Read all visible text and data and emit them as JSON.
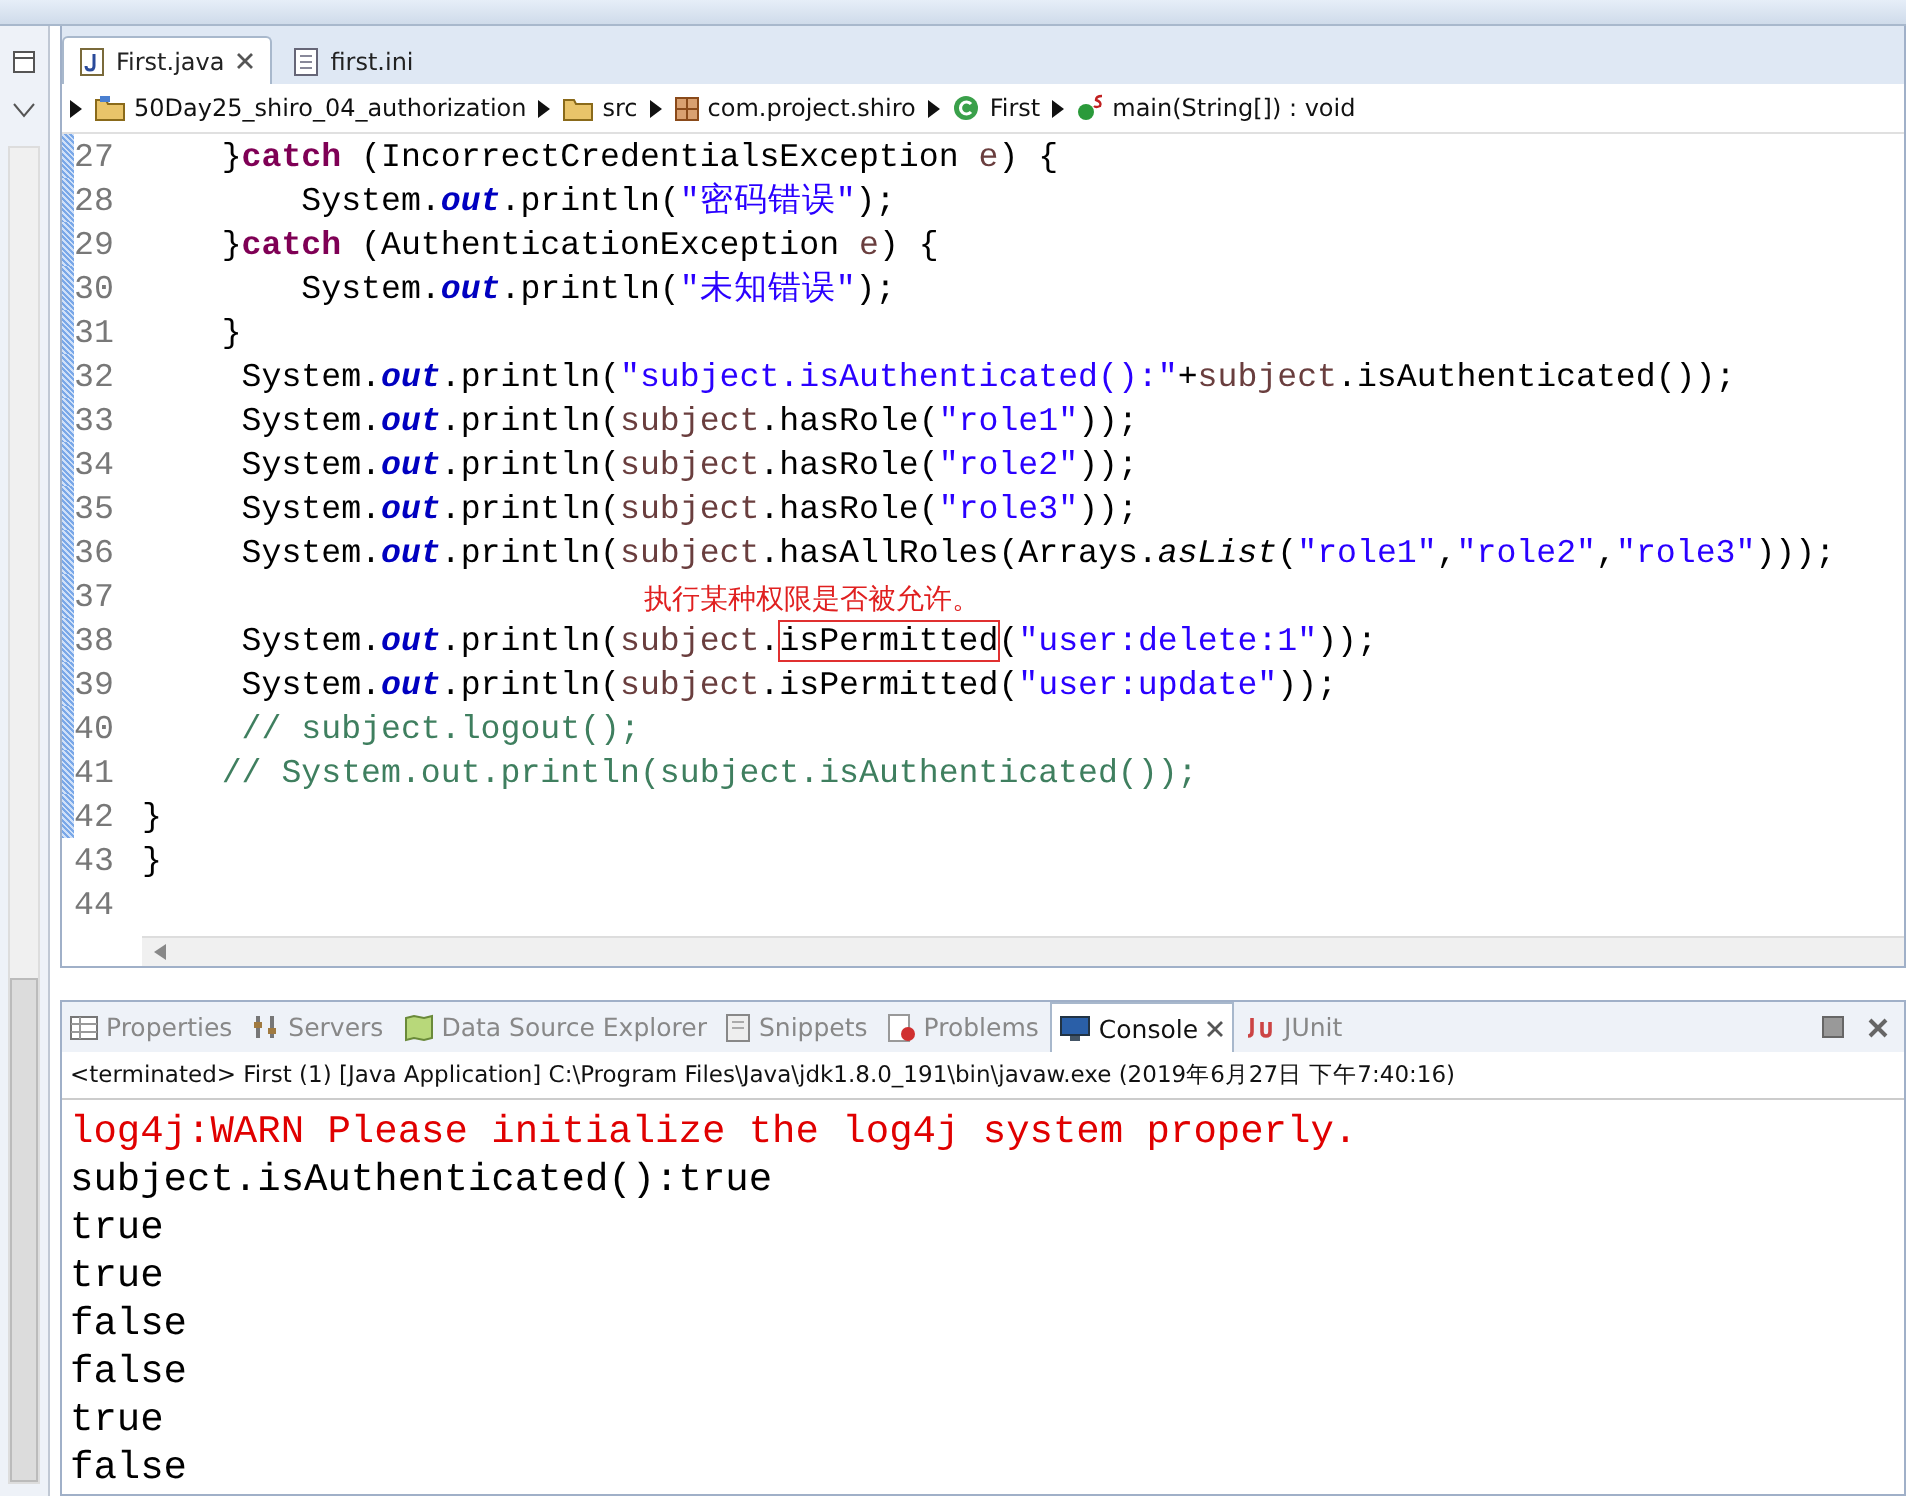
{
  "editor_tabs": [
    {
      "label": "First.java",
      "kind": "java",
      "selected": true,
      "closable": true
    },
    {
      "label": "first.ini",
      "kind": "file",
      "selected": false,
      "closable": false
    }
  ],
  "breadcrumb": [
    {
      "label": "50Day25_shiro_04_authorization",
      "kind": "project"
    },
    {
      "label": "src",
      "kind": "folder"
    },
    {
      "label": "com.project.shiro",
      "kind": "package"
    },
    {
      "label": "First",
      "kind": "class"
    },
    {
      "label": "main(String[]) : void",
      "kind": "method"
    }
  ],
  "code_lines": [
    {
      "number": "27",
      "changed": true,
      "segs": [
        {
          "t": "    }",
          "kind": "plain"
        },
        {
          "t": "catch",
          "kind": "kw"
        },
        {
          "t": " (IncorrectCredentialsException ",
          "kind": "plain"
        },
        {
          "t": "e",
          "kind": "var"
        },
        {
          "t": ") {",
          "kind": "plain"
        }
      ]
    },
    {
      "number": "28",
      "changed": true,
      "segs": [
        {
          "t": "        System.",
          "kind": "plain"
        },
        {
          "t": "out",
          "kind": "field"
        },
        {
          "t": ".println(",
          "kind": "plain"
        },
        {
          "t": "\"密码错误\"",
          "kind": "str"
        },
        {
          "t": ");",
          "kind": "plain"
        }
      ]
    },
    {
      "number": "29",
      "changed": true,
      "segs": [
        {
          "t": "    }",
          "kind": "plain"
        },
        {
          "t": "catch",
          "kind": "kw"
        },
        {
          "t": " (AuthenticationException ",
          "kind": "plain"
        },
        {
          "t": "e",
          "kind": "var"
        },
        {
          "t": ") {",
          "kind": "plain"
        }
      ]
    },
    {
      "number": "30",
      "changed": true,
      "segs": [
        {
          "t": "        System.",
          "kind": "plain"
        },
        {
          "t": "out",
          "kind": "field"
        },
        {
          "t": ".println(",
          "kind": "plain"
        },
        {
          "t": "\"未知错误\"",
          "kind": "str"
        },
        {
          "t": ");",
          "kind": "plain"
        }
      ]
    },
    {
      "number": "31",
      "changed": true,
      "segs": [
        {
          "t": "    }",
          "kind": "plain"
        }
      ]
    },
    {
      "number": "32",
      "changed": true,
      "segs": [
        {
          "t": "     System.",
          "kind": "plain"
        },
        {
          "t": "out",
          "kind": "field"
        },
        {
          "t": ".println(",
          "kind": "plain"
        },
        {
          "t": "\"subject.isAuthenticated():\"",
          "kind": "str"
        },
        {
          "t": "+",
          "kind": "plain"
        },
        {
          "t": "subject",
          "kind": "var"
        },
        {
          "t": ".isAuthenticated());",
          "kind": "plain"
        }
      ]
    },
    {
      "number": "33",
      "changed": true,
      "segs": [
        {
          "t": "     System.",
          "kind": "plain"
        },
        {
          "t": "out",
          "kind": "field"
        },
        {
          "t": ".println(",
          "kind": "plain"
        },
        {
          "t": "subject",
          "kind": "var"
        },
        {
          "t": ".hasRole(",
          "kind": "plain"
        },
        {
          "t": "\"role1\"",
          "kind": "str"
        },
        {
          "t": "));",
          "kind": "plain"
        }
      ]
    },
    {
      "number": "34",
      "changed": true,
      "segs": [
        {
          "t": "     System.",
          "kind": "plain"
        },
        {
          "t": "out",
          "kind": "field"
        },
        {
          "t": ".println(",
          "kind": "plain"
        },
        {
          "t": "subject",
          "kind": "var"
        },
        {
          "t": ".hasRole(",
          "kind": "plain"
        },
        {
          "t": "\"role2\"",
          "kind": "str"
        },
        {
          "t": "));",
          "kind": "plain"
        }
      ]
    },
    {
      "number": "35",
      "changed": true,
      "segs": [
        {
          "t": "     System.",
          "kind": "plain"
        },
        {
          "t": "out",
          "kind": "field"
        },
        {
          "t": ".println(",
          "kind": "plain"
        },
        {
          "t": "subject",
          "kind": "var"
        },
        {
          "t": ".hasRole(",
          "kind": "plain"
        },
        {
          "t": "\"role3\"",
          "kind": "str"
        },
        {
          "t": "));",
          "kind": "plain"
        }
      ]
    },
    {
      "number": "36",
      "changed": true,
      "segs": [
        {
          "t": "     System.",
          "kind": "plain"
        },
        {
          "t": "out",
          "kind": "field"
        },
        {
          "t": ".println(",
          "kind": "plain"
        },
        {
          "t": "subject",
          "kind": "var"
        },
        {
          "t": ".hasAllRoles(Arrays.",
          "kind": "plain"
        },
        {
          "t": "asList",
          "kind": "static"
        },
        {
          "t": "(",
          "kind": "plain"
        },
        {
          "t": "\"role1\"",
          "kind": "str"
        },
        {
          "t": ",",
          "kind": "plain"
        },
        {
          "t": "\"role2\"",
          "kind": "str"
        },
        {
          "t": ",",
          "kind": "plain"
        },
        {
          "t": "\"role3\"",
          "kind": "str"
        },
        {
          "t": ")));",
          "kind": "plain"
        }
      ]
    },
    {
      "number": "37",
      "changed": true,
      "note": "执行某种权限是否被允许。"
    },
    {
      "number": "38",
      "changed": true,
      "segs": [
        {
          "t": "     System.",
          "kind": "plain"
        },
        {
          "t": "out",
          "kind": "field"
        },
        {
          "t": ".println(",
          "kind": "plain"
        },
        {
          "t": "subject",
          "kind": "var"
        },
        {
          "t": ".",
          "kind": "plain"
        },
        {
          "t": "isPermitted",
          "kind": "boxed"
        },
        {
          "t": "(",
          "kind": "plain"
        },
        {
          "t": "\"user:delete:1\"",
          "kind": "str"
        },
        {
          "t": "));",
          "kind": "plain"
        }
      ]
    },
    {
      "number": "39",
      "changed": true,
      "segs": [
        {
          "t": "     System.",
          "kind": "plain"
        },
        {
          "t": "out",
          "kind": "field"
        },
        {
          "t": ".println(",
          "kind": "plain"
        },
        {
          "t": "subject",
          "kind": "var"
        },
        {
          "t": ".isPermitted(",
          "kind": "plain"
        },
        {
          "t": "\"user:update\"",
          "kind": "str"
        },
        {
          "t": "));",
          "kind": "plain"
        }
      ]
    },
    {
      "number": "40",
      "changed": true,
      "segs": [
        {
          "t": "     // subject.logout();",
          "kind": "comment"
        }
      ]
    },
    {
      "number": "41",
      "changed": true,
      "segs": [
        {
          "t": "    // System.out.println(subject.isAuthenticated());",
          "kind": "comment"
        }
      ]
    },
    {
      "number": "42",
      "changed": true,
      "segs": [
        {
          "t": "}",
          "kind": "plain"
        }
      ]
    },
    {
      "number": "43",
      "changed": false,
      "segs": [
        {
          "t": "}",
          "kind": "plain"
        }
      ]
    },
    {
      "number": "44",
      "changed": false
    }
  ],
  "view_tabs": [
    {
      "label": "Properties",
      "kind": "properties",
      "selected": false
    },
    {
      "label": "Servers",
      "kind": "servers",
      "selected": false
    },
    {
      "label": "Data Source Explorer",
      "kind": "datasource",
      "selected": false
    },
    {
      "label": "Snippets",
      "kind": "snippets",
      "selected": false
    },
    {
      "label": "Problems",
      "kind": "problems",
      "selected": false
    },
    {
      "label": "Console",
      "kind": "console",
      "selected": true
    },
    {
      "label": "JUnit",
      "kind": "junit",
      "selected": false
    }
  ],
  "console": {
    "header": "<terminated> First (1) [Java Application] C:\\Program Files\\Java\\jdk1.8.0_191\\bin\\javaw.exe (2019年6月27日 下午7:40:16)",
    "lines": [
      {
        "text": "log4j:WARN Please initialize the log4j system properly.",
        "kind": "error"
      },
      {
        "text": "subject.isAuthenticated():true",
        "kind": "output"
      },
      {
        "text": "true",
        "kind": "output"
      },
      {
        "text": "true",
        "kind": "output"
      },
      {
        "text": "false",
        "kind": "output"
      },
      {
        "text": "false",
        "kind": "output"
      },
      {
        "text": "true",
        "kind": "output"
      },
      {
        "text": "false",
        "kind": "output"
      }
    ]
  }
}
